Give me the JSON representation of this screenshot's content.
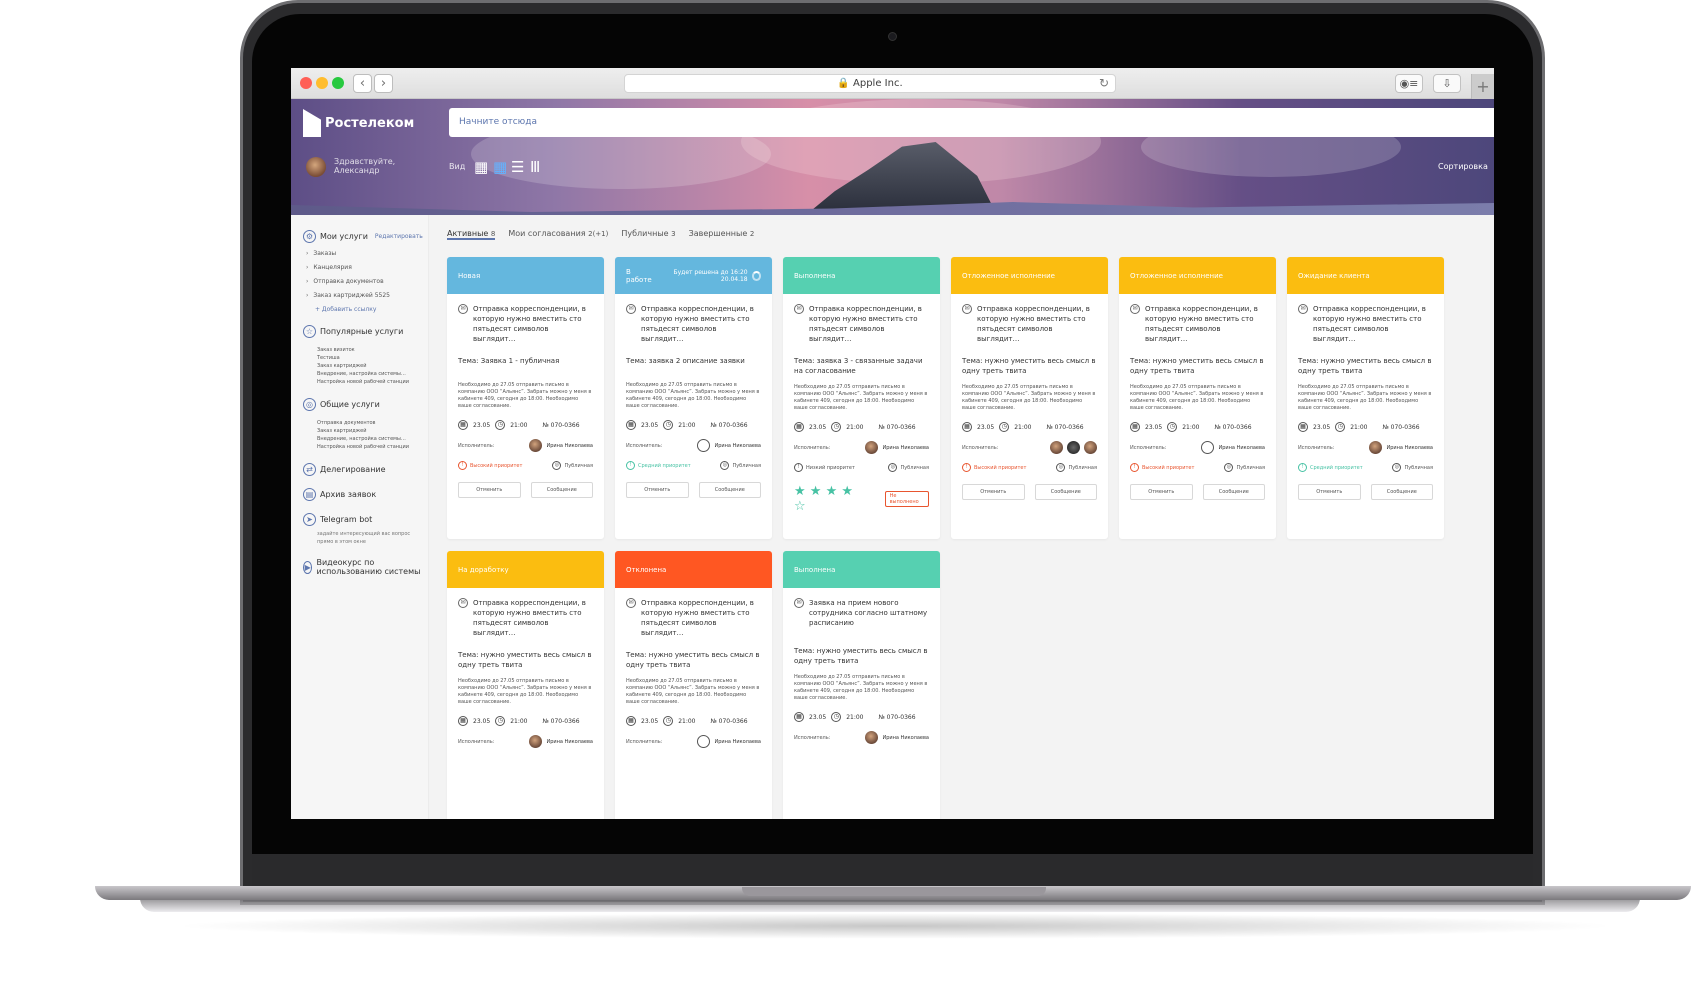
{
  "browser": {
    "address": "Apple Inc.",
    "back": "‹",
    "forward": "›",
    "reload": "↻",
    "reader": "◉≡",
    "download": "⇩",
    "new_tab": "+"
  },
  "header": {
    "logo": "Ростелеком",
    "greeting_line1": "Здравствуйте,",
    "greeting_line2": "Александр",
    "search_placeholder": "Начните отсюда",
    "view_label": "Вид",
    "view_icons": [
      "▦",
      "▦",
      "☰",
      "Ⅲ"
    ],
    "sort_label": "Сортировка"
  },
  "sidebar": {
    "my_services": "Мои услуги",
    "edit": "Редактировать",
    "my_items": [
      "Заказы",
      "Канцелярия",
      "Отправка документов",
      "Заказ картриджей 5525"
    ],
    "add_link": "+ Добавить ссылку",
    "popular_title": "Популярные услуги",
    "popular_items": [
      "Заказ визиток",
      "Тестиша",
      "Заказ картриджей",
      "Внедрение, настройка системы…",
      "Настройка новой рабочей станции"
    ],
    "general_title": "Общие услуги",
    "general_items": [
      "Отправка документов",
      "Заказ картриджей",
      "Внедрение, настройка системы…",
      "Настройка новой рабочей станции"
    ],
    "delegation": "Делегирование",
    "archive": "Архив заявок",
    "telegram": "Telegram bot",
    "telegram_note": "задайте интересующий вас вопрос прямо в этом окне",
    "video_course": "Видеокурс по использованию системы"
  },
  "tabs": [
    {
      "label": "Активные",
      "count": "8"
    },
    {
      "label": "Мои согласования",
      "count": "2(+1)"
    },
    {
      "label": "Публичные",
      "count": "3"
    },
    {
      "label": "Завершенные",
      "count": "2"
    }
  ],
  "cards": [
    {
      "status": "Новая",
      "color": "#64b7de",
      "subject": "Отправка корреспонденции, в которую нужно вместить сто пятьдесят символов выглядит…",
      "theme": "Тема: Заявка 1 - публичная",
      "desc": "Необходимо до 27.05 отправить письмо в компанию ООО “Альянс”. Забрать можно у меня в кабинете 409, сегодня до 18:00. Необходимо ваше согласование.",
      "date": "23.05",
      "time": "21:00",
      "number": "№ 070-0366",
      "executor": "Исполнитель:",
      "name": "Ирина Николаева",
      "priority": "Высокий приоритет",
      "type": "Публичная",
      "btn1": "Отменить",
      "btn2": "Сообщение"
    },
    {
      "status": "В работе",
      "color": "#64b7de",
      "side": "Будет решена до 16:20  20.04.18",
      "subject": "Отправка корреспонденции, в которую нужно вместить сто пятьдесят символов выглядит…",
      "theme": "Тема: заявка 2 описание заявки",
      "desc": "Необходимо до 27.05 отправить письмо в компанию ООО “Альянс”. Забрать можно у меня в кабинете 409, сегодня до 18:00. Необходимо ваше согласование.",
      "date": "23.05",
      "time": "21:00",
      "number": "№ 070-0366",
      "executor": "Исполнитель:",
      "name": "Ирина Николаева",
      "priority": "Средний приоритет",
      "type": "Публичная",
      "btn1": "Отменить",
      "btn2": "Сообщение"
    },
    {
      "status": "Выполнена",
      "color": "#56d0b1",
      "subject": "Отправка корреспонденции, в которую нужно вместить сто пятьдесят символов выглядит…",
      "theme": "Тема: заявка 3 - связанные задачи на согласование",
      "desc": "Необходимо до 27.05 отправить письмо в компанию ООО “Альянс”. Забрать можно у меня в кабинете 409, сегодня до 18:00. Необходимо ваше согласование.",
      "date": "23.05",
      "time": "21:00",
      "number": "№ 070-0366",
      "executor": "Исполнитель:",
      "name": "Ирина Николаева",
      "priority": "Низкий приоритет",
      "type": "Публичная",
      "stars": "★ ★ ★ ★ ☆",
      "fail": "Не выполнено"
    },
    {
      "status": "Отложенное исполнение",
      "color": "#fbbd10",
      "subject": "Отправка корреспонденции, в которую нужно вместить сто пятьдесят символов выглядит…",
      "theme": "Тема: нужно уместить весь смысл в одну треть твита",
      "desc": "Необходимо до 27.05 отправить письмо в компанию ООО “Альянс”. Забрать можно у меня в кабинете 409, сегодня до 18:00. Необходимо ваше согласование.",
      "date": "23.05",
      "time": "21:00",
      "number": "№ 070-0366",
      "executor": "Исполнитель:",
      "priority": "Высокий приоритет",
      "type": "Публичная",
      "btn1": "Отменить",
      "btn2": "Сообщение"
    },
    {
      "status": "Отложенное исполнение",
      "color": "#fbbd10",
      "subject": "Отправка корреспонденции, в которую нужно вместить сто пятьдесят символов выглядит…",
      "theme": "Тема: нужно уместить весь смысл в одну треть твита",
      "desc": "Необходимо до 27.05 отправить письмо в компанию ООО “Альянс”. Забрать можно у меня в кабинете 409, сегодня до 18:00. Необходимо ваше согласование.",
      "date": "23.05",
      "time": "21:00",
      "number": "№ 070-0366",
      "executor": "Исполнитель:",
      "name": "Ирина Николаева",
      "priority": "Высокий приоритет",
      "type": "Публичная",
      "btn1": "Отменить",
      "btn2": "Сообщение"
    },
    {
      "status": "Ожидание клиента",
      "color": "#fbbd10",
      "subject": "Отправка корреспонденции, в которую нужно вместить сто пятьдесят символов выглядит…",
      "theme": "Тема: нужно уместить весь смысл в одну треть твита",
      "desc": "Необходимо до 27.05 отправить письмо в компанию ООО “Альянс”. Забрать можно у меня в кабинете 409, сегодня до 18:00. Необходимо ваше согласование.",
      "date": "23.05",
      "time": "21:00",
      "number": "№ 070-0366",
      "executor": "Исполнитель:",
      "name": "Ирина Николаева",
      "priority": "Средний приоритет",
      "type": "Публичная",
      "btn1": "Отменить",
      "btn2": "Сообщение"
    },
    {
      "status": "На доработку",
      "color": "#fbbd10",
      "subject": "Отправка корреспонденции, в которую нужно вместить сто пятьдесят символов выглядит…",
      "theme": "Тема: нужно уместить весь смысл в одну треть твита",
      "desc": "Необходимо до 27.05 отправить письмо в компанию ООО “Альянс”. Забрать можно у меня в кабинете 409, сегодня до 18:00. Необходимо ваше согласование.",
      "date": "23.05",
      "time": "21:00",
      "number": "№ 070-0366",
      "executor": "Исполнитель:",
      "name": "Ирина Николаева"
    },
    {
      "status": "Отклонена",
      "color": "#ff5722",
      "subject": "Отправка корреспонденции, в которую нужно вместить сто пятьдесят символов выглядит…",
      "theme": "Тема: нужно уместить весь смысл в одну треть твита",
      "desc": "Необходимо до 27.05 отправить письмо в компанию ООО “Альянс”. Забрать можно у меня в кабинете 409, сегодня до 18:00. Необходимо ваше согласование.",
      "date": "23.05",
      "time": "21:00",
      "number": "№ 070-0366",
      "executor": "Исполнитель:",
      "name": "Ирина Николаева"
    },
    {
      "status": "Выполнена",
      "color": "#56d0b1",
      "subject": "Заявка на прием нового сотрудника согласно штатному расписанию",
      "theme": "Тема: нужно уместить весь смысл в одну треть твита",
      "desc": "Необходимо до 27.05 отправить письмо в компанию ООО “Альянс”. Забрать можно у меня в кабинете 409, сегодня до 18:00. Необходимо ваше согласование.",
      "date": "23.05",
      "time": "21:00",
      "number": "№ 070-0366",
      "executor": "Исполнитель:",
      "name": "Ирина Николаева"
    }
  ]
}
